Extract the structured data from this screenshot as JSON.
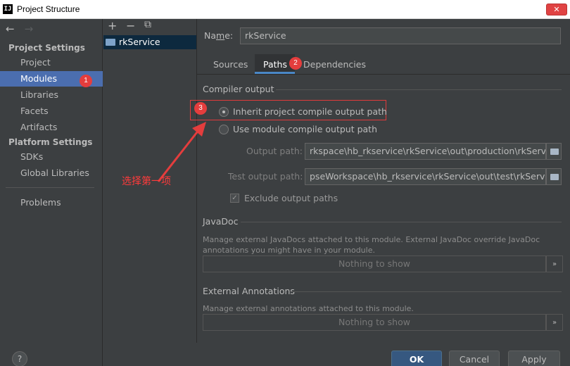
{
  "window": {
    "title": "Project Structure",
    "app_icon": "IJ",
    "close": "✕"
  },
  "nav": {
    "back": "←",
    "forward": "→"
  },
  "sidebar": {
    "project_settings_header": "Project Settings",
    "project_items": [
      "Project",
      "Modules",
      "Libraries",
      "Facets",
      "Artifacts"
    ],
    "platform_settings_header": "Platform Settings",
    "platform_items": [
      "SDKs",
      "Global Libraries"
    ],
    "problems": "Problems",
    "selected": "Modules"
  },
  "module_list": {
    "add": "+",
    "remove": "−",
    "copy": "⧉",
    "items": [
      "rkService"
    ]
  },
  "name_field": {
    "label_pre": "Na",
    "label_mnemonic": "m",
    "label_post": "e:",
    "value": "rkService"
  },
  "tabs": [
    "Sources",
    "Paths",
    "Dependencies"
  ],
  "selected_tab": "Paths",
  "compiler_output": {
    "title": "Compiler output",
    "inherit_label": "Inherit project compile output path",
    "use_module_label": "Use module compile output path",
    "selected": "inherit",
    "output_path_label": "Output path:",
    "output_path_value": "rkspace\\hb_rkservice\\rkService\\out\\production\\rkService",
    "test_output_path_label": "Test output path:",
    "test_output_path_value": "pseWorkspace\\hb_rkservice\\rkService\\out\\test\\rkService",
    "exclude_label": "Exclude output paths",
    "exclude_checked": true
  },
  "javadoc": {
    "title": "JavaDoc",
    "description_line1": "Manage external JavaDocs attached to this module. External JavaDoc override JavaDoc",
    "description_line2": "annotations you might have in your module.",
    "empty_text": "Nothing to show",
    "more": "»"
  },
  "external_annotations": {
    "title": "External Annotations",
    "description": "Manage external annotations attached to this module.",
    "empty_text": "Nothing to show",
    "more": "»"
  },
  "annotations": {
    "badge1": "1",
    "badge2": "2",
    "badge3": "3",
    "arrow_text": "选择第一项",
    "color": "#e43d3d"
  },
  "buttons": {
    "help": "?",
    "ok": "OK",
    "cancel": "Cancel",
    "apply": "Apply"
  }
}
